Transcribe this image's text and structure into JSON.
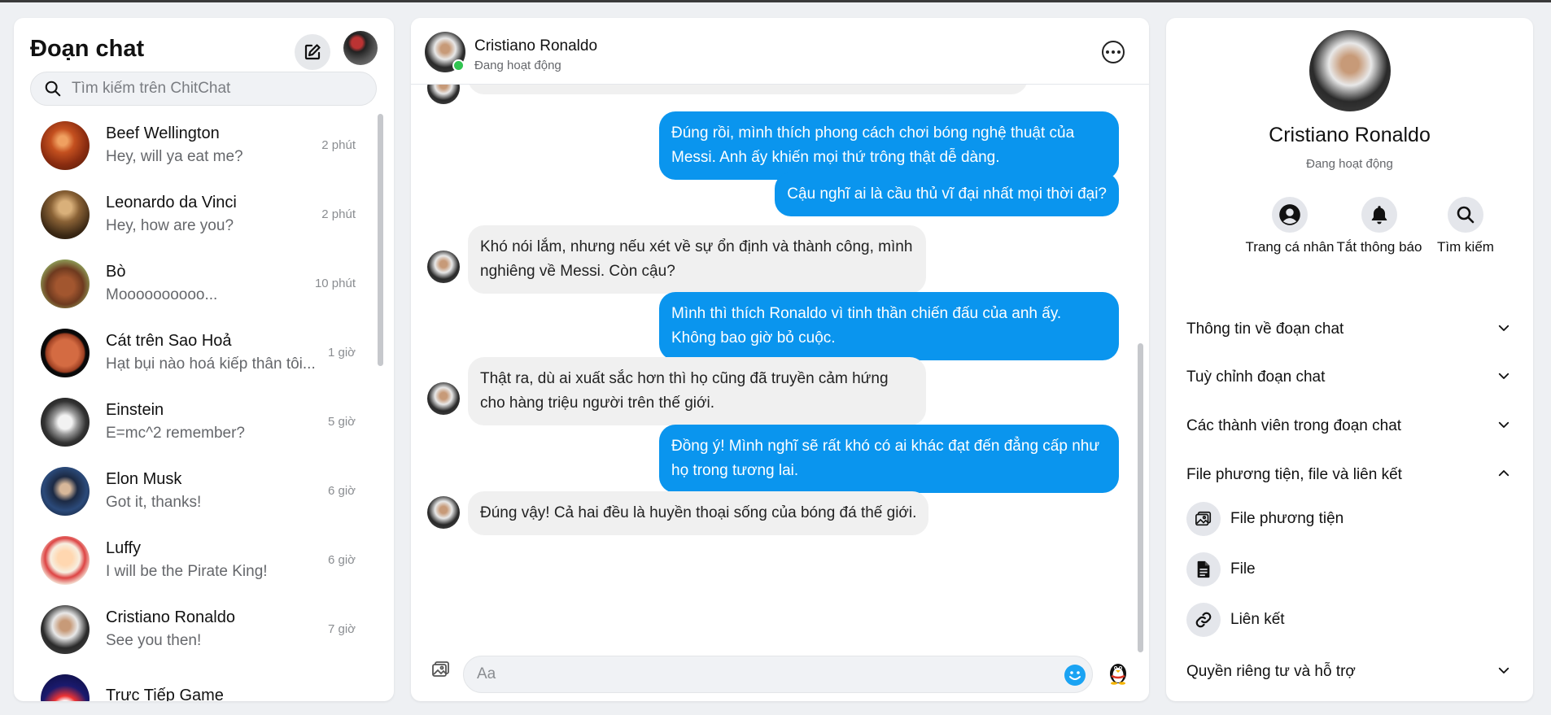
{
  "sidebar": {
    "title": "Đoạn chat",
    "search_placeholder": "Tìm kiếm trên ChitChat",
    "conversations": [
      {
        "name": "Beef Wellington",
        "preview": "Hey, will ya eat me?",
        "time": "2 phút"
      },
      {
        "name": "Leonardo da Vinci",
        "preview": "Hey, how are you?",
        "time": "2 phút"
      },
      {
        "name": "Bò",
        "preview": "Moooooooooo...",
        "time": "10 phút"
      },
      {
        "name": "Cát trên Sao Hoả",
        "preview": "Hạt bụi nào hoá kiếp thân tôi...",
        "time": "1 giờ"
      },
      {
        "name": "Einstein",
        "preview": "E=mc^2 remember?",
        "time": "5 giờ"
      },
      {
        "name": "Elon Musk",
        "preview": "Got it, thanks!",
        "time": "6 giờ"
      },
      {
        "name": "Luffy",
        "preview": "I will be the Pirate King!",
        "time": "6 giờ"
      },
      {
        "name": "Cristiano Ronaldo",
        "preview": "See you then!",
        "time": "7 giờ"
      },
      {
        "name": "Trực Tiếp Game",
        "preview": "",
        "time": ""
      }
    ]
  },
  "chat": {
    "name": "Cristiano Ronaldo",
    "status": "Đang hoạt động",
    "messages": [
      {
        "dir": "out",
        "text": "Đúng rồi, mình thích phong cách chơi bóng nghệ thuật của Messi. Anh ấy khiến mọi thứ trông thật dễ dàng."
      },
      {
        "dir": "out",
        "text": "Cậu nghĩ ai là cầu thủ vĩ đại nhất mọi thời đại?"
      },
      {
        "dir": "in",
        "text": "Khó nói lắm, nhưng nếu xét về sự ổn định và thành công, mình nghiêng về Messi. Còn cậu?"
      },
      {
        "dir": "out",
        "text": "Mình thì thích Ronaldo vì tinh thần chiến đấu của anh ấy. Không bao giờ bỏ cuộc."
      },
      {
        "dir": "in",
        "text": "Thật ra, dù ai xuất sắc hơn thì họ cũng đã truyền cảm hứng cho hàng triệu người trên thế giới."
      },
      {
        "dir": "out",
        "text": "Đồng ý! Mình nghĩ sẽ rất khó có ai khác đạt đến đẳng cấp như họ trong tương lai."
      },
      {
        "dir": "in",
        "text": "Đúng vậy! Cả hai đều là huyền thoại sống của bóng đá thế giới."
      }
    ],
    "input_placeholder": "Aa"
  },
  "profile": {
    "name": "Cristiano Ronaldo",
    "status": "Đang hoạt động",
    "actions": [
      {
        "label": "Trang cá nhân",
        "icon": "user-circle-icon"
      },
      {
        "label": "Tắt thông báo",
        "icon": "bell-icon"
      },
      {
        "label": "Tìm kiếm",
        "icon": "search-icon"
      }
    ],
    "sections": [
      {
        "title": "Thông tin về đoạn chat",
        "expanded": false
      },
      {
        "title": "Tuỳ chỉnh đoạn chat",
        "expanded": false
      },
      {
        "title": "Các thành viên trong đoạn chat",
        "expanded": false
      },
      {
        "title": "File phương tiện, file và liên kết",
        "expanded": true
      },
      {
        "title": "Quyền riêng tư và hỗ trợ",
        "expanded": false
      }
    ],
    "media_items": [
      {
        "label": "File phương tiện",
        "icon": "image-icon"
      },
      {
        "label": "File",
        "icon": "file-icon"
      },
      {
        "label": "Liên kết",
        "icon": "link-icon"
      }
    ]
  },
  "colors": {
    "accent": "#0a95ee",
    "incoming_bubble": "#f0f0f0",
    "online": "#31c451",
    "background": "#eef0f3"
  }
}
